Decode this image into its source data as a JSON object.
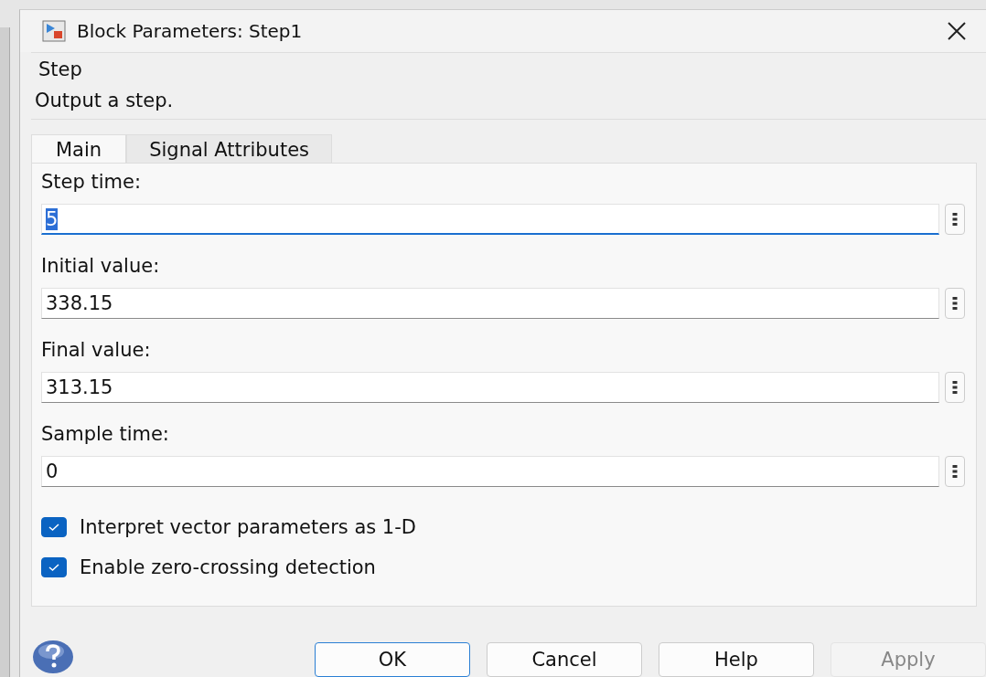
{
  "window": {
    "title": "Block Parameters: Step1"
  },
  "group": {
    "title": "Step",
    "description": "Output a step."
  },
  "tabs": [
    {
      "label": "Main",
      "selected": true
    },
    {
      "label": "Signal Attributes",
      "selected": false
    }
  ],
  "fields": [
    {
      "label": "Step time:",
      "value": "5",
      "focused": true
    },
    {
      "label": "Initial value:",
      "value": "338.15",
      "focused": false
    },
    {
      "label": "Final value:",
      "value": "313.15",
      "focused": false
    },
    {
      "label": "Sample time:",
      "value": "0",
      "focused": false
    }
  ],
  "checkboxes": [
    {
      "label": "Interpret vector parameters as 1-D",
      "checked": true
    },
    {
      "label": "Enable zero-crossing detection",
      "checked": true
    }
  ],
  "buttons": [
    {
      "label": "OK",
      "default": true,
      "disabled": false
    },
    {
      "label": "Cancel",
      "default": false,
      "disabled": false
    },
    {
      "label": "Help",
      "default": false,
      "disabled": false
    },
    {
      "label": "Apply",
      "default": false,
      "disabled": true
    }
  ]
}
